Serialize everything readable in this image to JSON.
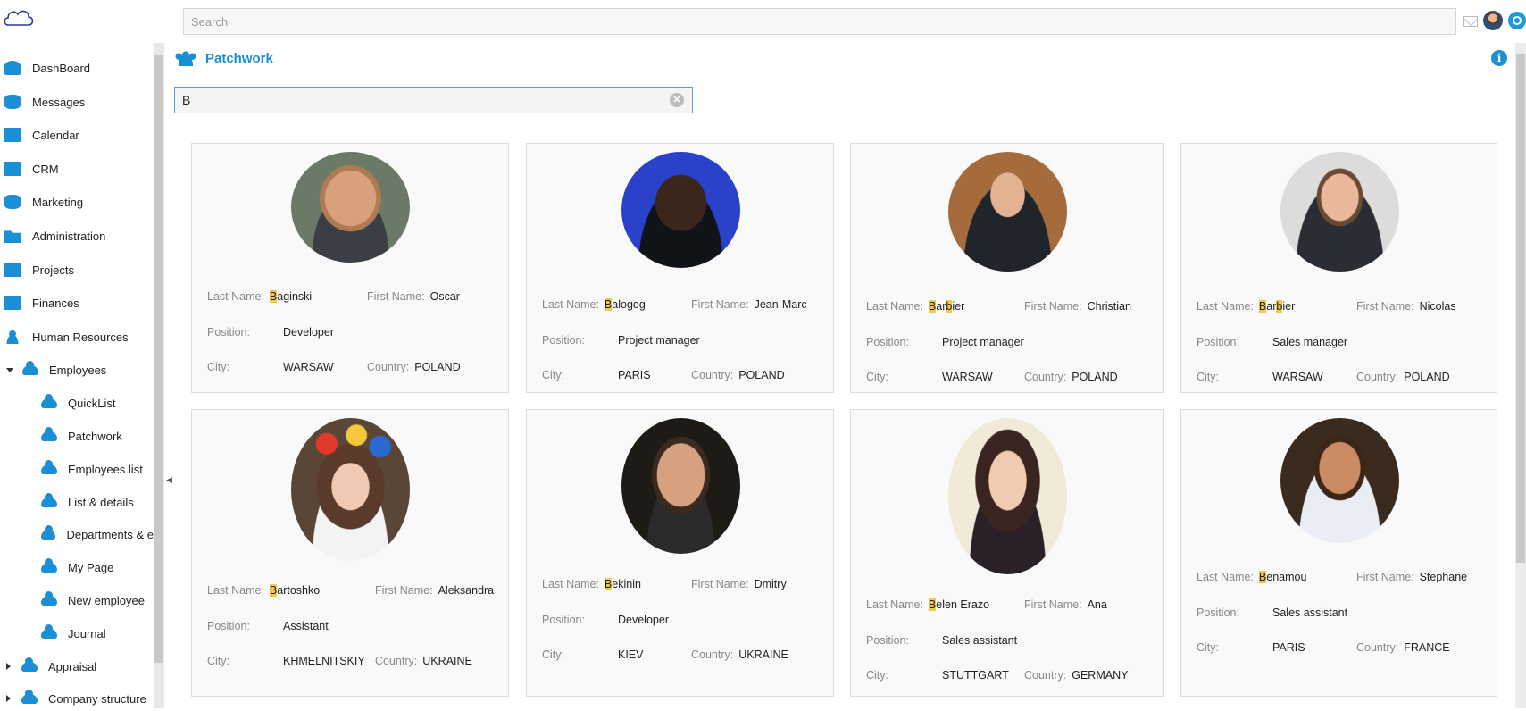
{
  "header": {
    "search_placeholder": "Search",
    "icons": [
      "mail-icon",
      "user-avatar",
      "help-icon"
    ]
  },
  "sidebar": {
    "items": [
      {
        "label": "DashBoard",
        "icon": "dashboard-icon"
      },
      {
        "label": "Messages",
        "icon": "messages-icon"
      },
      {
        "label": "Calendar",
        "icon": "calendar-icon"
      },
      {
        "label": "CRM",
        "icon": "crm-icon"
      },
      {
        "label": "Marketing",
        "icon": "marketing-icon"
      },
      {
        "label": "Administration",
        "icon": "folder-icon"
      },
      {
        "label": "Projects",
        "icon": "briefcase-icon"
      },
      {
        "label": "Finances",
        "icon": "finances-icon"
      },
      {
        "label": "Human Resources",
        "icon": "people-icon"
      },
      {
        "label": "Employees",
        "icon": "cloud-icon"
      },
      {
        "label": "QuickList",
        "icon": "cloud-icon"
      },
      {
        "label": "Patchwork",
        "icon": "cloud-icon"
      },
      {
        "label": "Employees list",
        "icon": "cloud-icon"
      },
      {
        "label": "List & details",
        "icon": "cloud-icon"
      },
      {
        "label": "Departments & e",
        "icon": "cloud-icon"
      },
      {
        "label": "My Page",
        "icon": "cloud-icon"
      },
      {
        "label": "New employee",
        "icon": "cloud-icon"
      },
      {
        "label": "Journal",
        "icon": "cloud-icon"
      },
      {
        "label": "Appraisal",
        "icon": "cloud-icon"
      },
      {
        "label": "Company structure",
        "icon": "cloud-icon"
      }
    ]
  },
  "page": {
    "title": "Patchwork",
    "filter_value": "B"
  },
  "labels": {
    "last_name": "Last Name:",
    "first_name": "First Name:",
    "position": "Position:",
    "city": "City:",
    "country": "Country:"
  },
  "employees": [
    {
      "hl": "B",
      "last_rest": "aginski",
      "first": "Oscar",
      "position": "Developer",
      "city": "WARSAW",
      "country": "POLAND"
    },
    {
      "hl": "B",
      "last_rest": "alogog",
      "first": "Jean-Marc",
      "position": "Project manager",
      "city": "PARIS",
      "country": "POLAND"
    },
    {
      "last_pre": "",
      "hl": "B",
      "last_mid": "ar",
      "hl2": "b",
      "last_rest": "ier",
      "first": "Christian",
      "position": "Project manager",
      "city": "WARSAW",
      "country": "POLAND"
    },
    {
      "last_pre": "",
      "hl": "B",
      "last_mid": "ar",
      "hl2": "b",
      "last_rest": "ier",
      "first": "Nicolas",
      "position": "Sales manager",
      "city": "WARSAW",
      "country": "POLAND"
    },
    {
      "hl": "B",
      "last_rest": "artoshko",
      "first": "Aleksandra",
      "position": "Assistant",
      "city": "KHMELNITSKIY",
      "country": "UKRAINE"
    },
    {
      "hl": "B",
      "last_rest": "ekinin",
      "first": "Dmitry",
      "position": "Developer",
      "city": "KIEV",
      "country": "UKRAINE"
    },
    {
      "hl": "B",
      "last_rest": "elen Erazo",
      "first": "Ana",
      "position": "Sales assistant",
      "city": "STUTTGART",
      "country": "GERMANY"
    },
    {
      "hl": "B",
      "last_rest": "enamou",
      "first": "Stephane",
      "position": "Sales assistant",
      "city": "PARIS",
      "country": "FRANCE"
    }
  ],
  "colors": {
    "accent": "#1a8fd6",
    "highlight": "#f3c94a"
  }
}
